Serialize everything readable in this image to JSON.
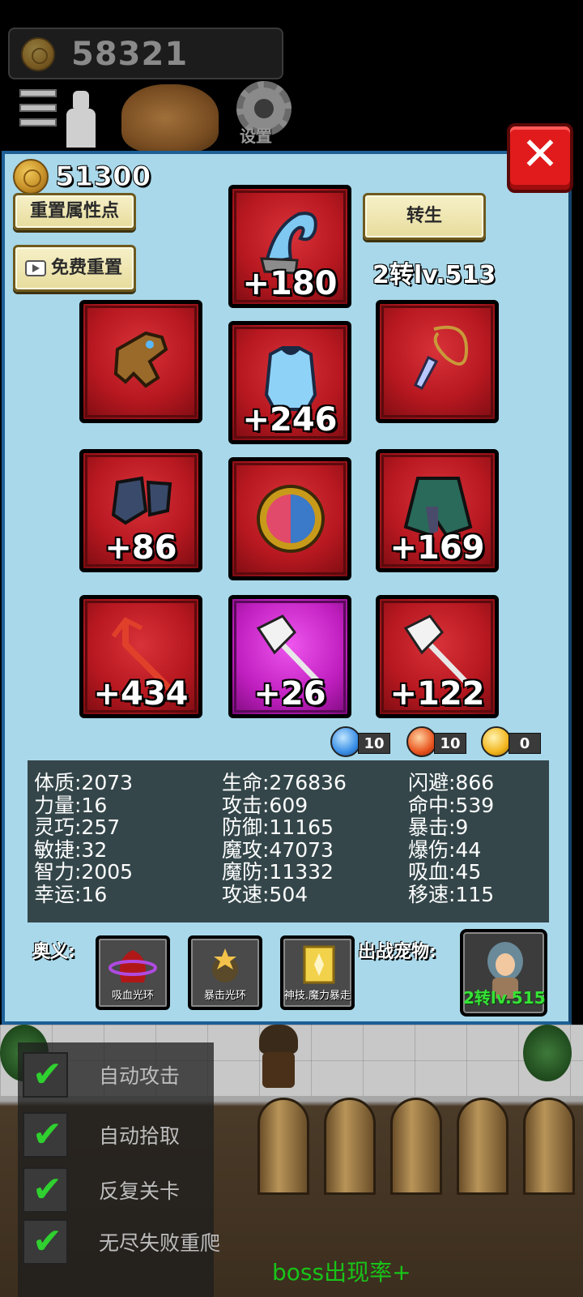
{
  "top_gold": "58321",
  "settings_label": "设置",
  "close_label": "✕",
  "panel": {
    "gold": "51300",
    "reset_button": "重置属性点",
    "free_reset_button": "免费重置",
    "rebirth_button": "转生",
    "rebirth_level": "2转lv.513"
  },
  "equipment": [
    {
      "name": "hat",
      "plus": "+180"
    },
    {
      "name": "gloves",
      "plus": ""
    },
    {
      "name": "armor",
      "plus": "+246"
    },
    {
      "name": "necklace",
      "plus": ""
    },
    {
      "name": "boots",
      "plus": "+86"
    },
    {
      "name": "orb",
      "plus": ""
    },
    {
      "name": "cape",
      "plus": "+169"
    },
    {
      "name": "trident",
      "plus": "+434"
    },
    {
      "name": "axe-epic",
      "plus": "+26"
    },
    {
      "name": "axe",
      "plus": "+122"
    }
  ],
  "gems": [
    {
      "name": "water",
      "count": "10",
      "color": "#3a8ee6"
    },
    {
      "name": "fire",
      "count": "10",
      "color": "#e8531e"
    },
    {
      "name": "thunder",
      "count": "0",
      "color": "#f2b51c"
    }
  ],
  "stats": {
    "col1": [
      "体质:2073",
      "力量:16",
      "灵巧:257",
      "敏捷:32",
      "智力:2005",
      "幸运:16"
    ],
    "col2": [
      "生命:276836",
      "攻击:609",
      "防御:11165",
      "魔攻:47073",
      "魔防:11332",
      "攻速:504"
    ],
    "col3": [
      "闪避:866",
      "命中:539",
      "暴击:9",
      "爆伤:44",
      "吸血:45",
      "移速:115"
    ]
  },
  "skills_label": "奥义:",
  "skills": [
    "吸血光环",
    "暴击光环",
    "神技.魔力暴走"
  ],
  "pet_label": "出战宠物:",
  "pet_badge": "2转lv.515",
  "toggles": [
    {
      "label": "自动攻击",
      "checked": true
    },
    {
      "label": "自动拾取",
      "checked": true
    },
    {
      "label": "反复关卡",
      "checked": true
    },
    {
      "label": "无尽失败重爬",
      "checked": true
    }
  ],
  "boss_text": "boss出现率+"
}
